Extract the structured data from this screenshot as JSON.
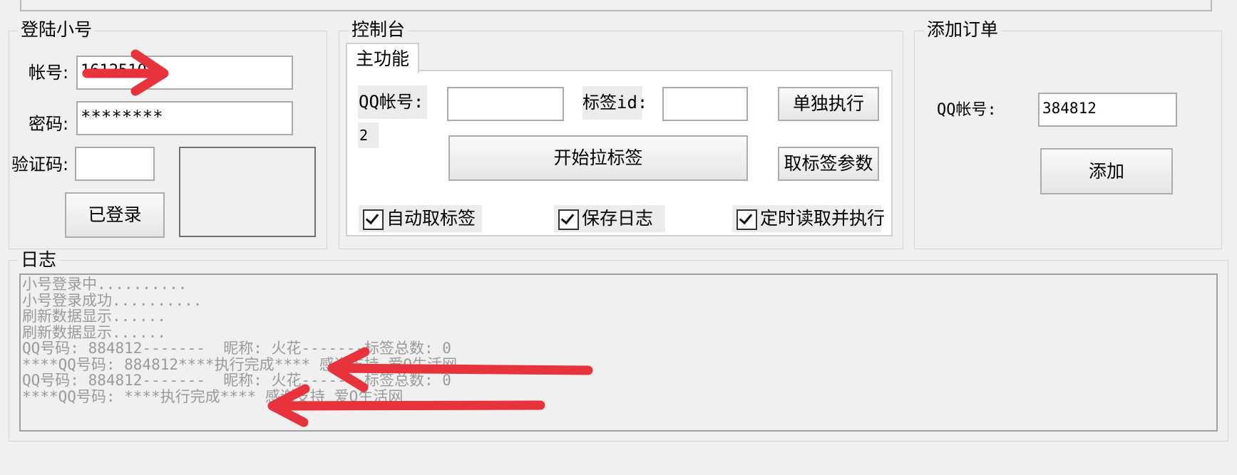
{
  "login": {
    "legend": "登陆小号",
    "account_label": "帐号:",
    "account_value": "16125101",
    "password_label": "密码:",
    "password_value": "********",
    "captcha_label": "验证码:",
    "captcha_value": "",
    "login_button": "已登录"
  },
  "console": {
    "legend": "控制台",
    "tab_main": "主功能",
    "qq_label": "QQ帐号:",
    "qq_value": "",
    "tag_id_label": "标签id:",
    "tag_id_value": "",
    "single_exec_button": "单独执行",
    "stray_text": "2",
    "start_button": "开始拉标签",
    "get_params_button": "取标签参数",
    "auto_get_tags": "自动取标签",
    "save_log": "保存日志",
    "timed_exec": "定时读取并执行"
  },
  "add_order": {
    "legend": "添加订单",
    "qq_label": "QQ帐号:",
    "qq_value": "384812",
    "add_button": "添加"
  },
  "log": {
    "legend": "日志",
    "lines": [
      "小号登录中..........",
      "小号登录成功..........",
      "刷新数据显示......",
      "刷新数据显示......",
      "QQ号码: 884812-------  昵称: 火花-------标签总数: 0",
      "****QQ号码: 884812****执行完成**** 感谢支持 爱Q生活网",
      "QQ号码: 884812-------  昵称: 火花-------标签总数: 0",
      "****QQ号码: ****执行完成**** 感谢支持 爱Q生活网"
    ]
  },
  "colors": {
    "annotation_arrow": "#e8323c",
    "window_bg": "#f0f0f0",
    "log_text": "#9a9a9a"
  }
}
